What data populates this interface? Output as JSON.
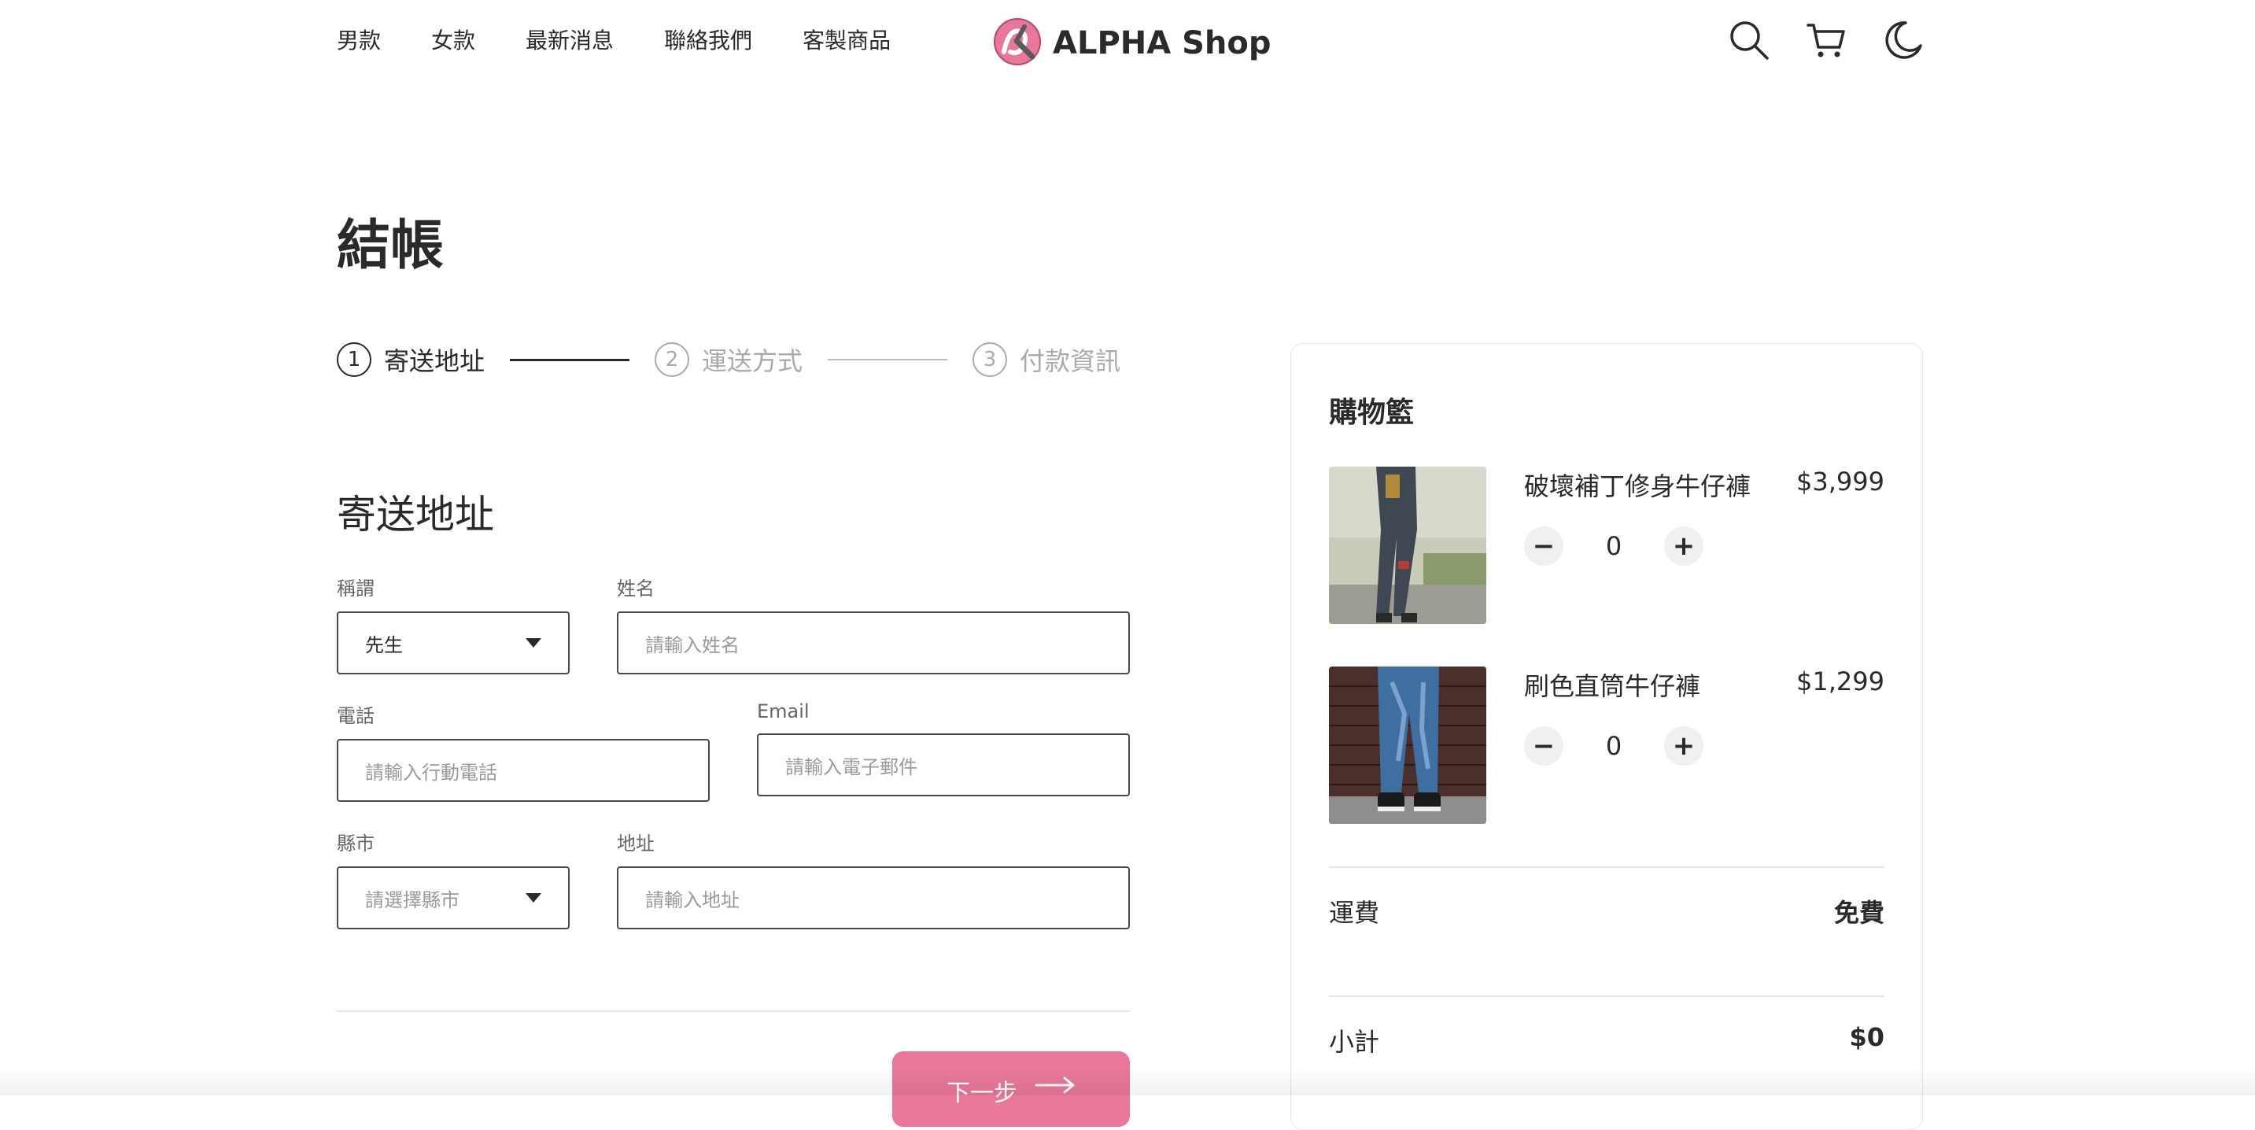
{
  "header": {
    "nav": [
      "男款",
      "女款",
      "最新消息",
      "聯絡我們",
      "客製商品"
    ],
    "logo_text": "ALPHA Shop",
    "icons": [
      "search-icon",
      "cart-icon",
      "moon-icon"
    ]
  },
  "main": {
    "title": "結帳",
    "steps": [
      {
        "number": "1",
        "label": "寄送地址",
        "active": true
      },
      {
        "number": "2",
        "label": "運送方式",
        "active": false
      },
      {
        "number": "3",
        "label": "付款資訊",
        "active": false
      }
    ],
    "section_title": "寄送地址",
    "form": {
      "salutation": {
        "label": "稱謂",
        "value": "先生"
      },
      "name": {
        "label": "姓名",
        "placeholder": "請輸入姓名"
      },
      "phone": {
        "label": "電話",
        "placeholder": "請輸入行動電話"
      },
      "email": {
        "label": "Email",
        "placeholder": "請輸入電子郵件"
      },
      "city": {
        "label": "縣市",
        "placeholder": "請選擇縣市"
      },
      "address": {
        "label": "地址",
        "placeholder": "請輸入地址"
      }
    },
    "next_button": "下一步"
  },
  "cart": {
    "title": "購物籃",
    "items": [
      {
        "name": "破壞補丁修身牛仔褲",
        "price": "$3,999",
        "quantity": "0"
      },
      {
        "name": "刷色直筒牛仔褲",
        "price": "$1,299",
        "quantity": "0"
      }
    ],
    "shipping": {
      "label": "運費",
      "value": "免費"
    },
    "subtotal": {
      "label": "小計",
      "value": "$0"
    }
  },
  "colors": {
    "accent": "#e8779a",
    "text": "#2a2a2a",
    "muted": "#aaaaaa"
  }
}
